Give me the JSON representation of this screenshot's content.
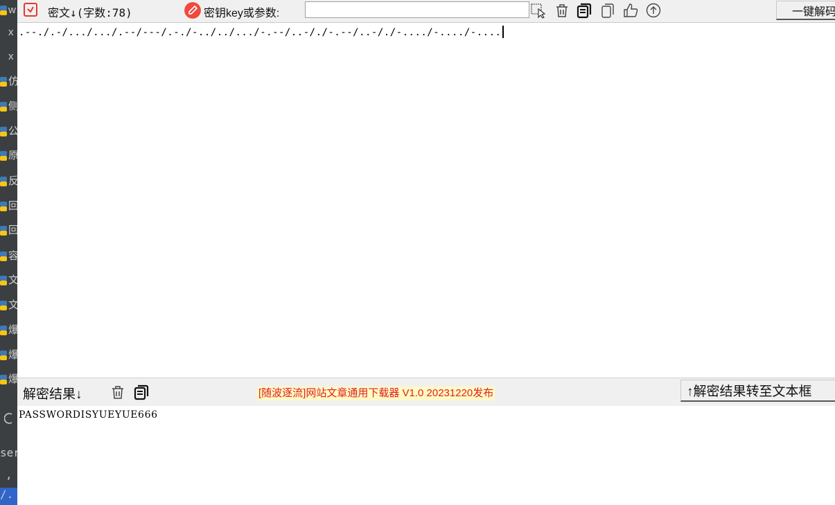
{
  "left_panel": {
    "chars": [
      "w",
      "x",
      "x",
      "仿",
      "侧",
      "公",
      "原",
      "反",
      "回",
      "回",
      "容",
      "文",
      "文",
      "爆",
      "爆",
      "爆"
    ],
    "bottom_chars": [
      "ser",
      ",",
      "/."
    ]
  },
  "toolbar": {
    "ciphertext_label": "密文↓(字数:78)",
    "key_label": "密钥key或参数:",
    "key_value": "",
    "decrypt_button": "一键解码"
  },
  "cipher": {
    "text": ".--./.-/.../.../.--/---/.-./-../../.../-.--/..-/./-.--/..-/./-..../-..../-...."
  },
  "result_bar": {
    "label": "解密结果↓",
    "promo": "[随波逐流]网站文章通用下载器 V1.0 20231220发布",
    "transfer_button": "↑解密结果转至文本框"
  },
  "result": {
    "text": "PASSWORDISYUEYUE666"
  },
  "colors": {
    "accent_red": "#f04a3c",
    "promo_text": "#e02020",
    "promo_bg": "#fff9c4"
  },
  "icons": [
    "select-icon",
    "trash-icon",
    "copy-icon",
    "paste-icon",
    "thumbs-up-icon",
    "arrow-up-icon"
  ]
}
